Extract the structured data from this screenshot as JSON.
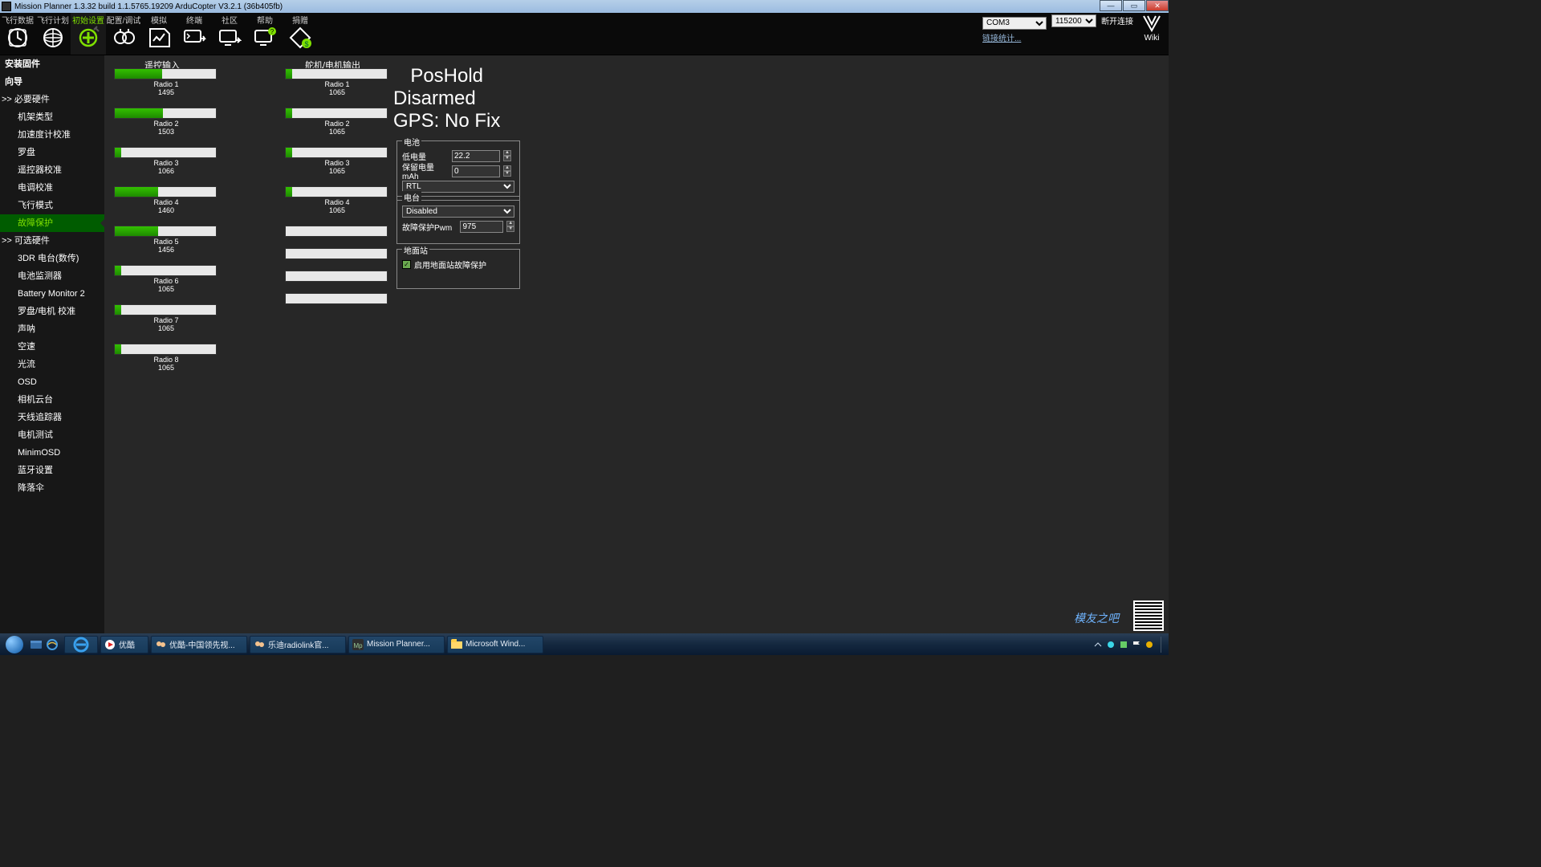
{
  "title": "Mission Planner 1.3.32 build 1.1.5765.19209 ArduCopter V3.2.1 (36b405fb)",
  "menu": {
    "items": [
      "飞行数据",
      "飞行计划",
      "初始设置",
      "配置/调试",
      "模拟",
      "终端",
      "社区",
      "帮助",
      "捐赠"
    ],
    "selected": 2,
    "com_port": "COM3",
    "baud": "115200",
    "disconnect": "断开连接",
    "stats_link": "链接统计...",
    "wiki": "Wiki"
  },
  "sidebar": [
    {
      "t": "安装固件",
      "k": "hdr"
    },
    {
      "t": "向导",
      "k": "hdr"
    },
    {
      "t": "必要硬件",
      "k": "grp"
    },
    {
      "t": "机架类型",
      "k": "sub"
    },
    {
      "t": "加速度计校准",
      "k": "sub"
    },
    {
      "t": "罗盘",
      "k": "sub"
    },
    {
      "t": "遥控器校准",
      "k": "sub"
    },
    {
      "t": "电调校准",
      "k": "sub"
    },
    {
      "t": "飞行模式",
      "k": "sub"
    },
    {
      "t": "故障保护",
      "k": "sub",
      "sel": true
    },
    {
      "t": "可选硬件",
      "k": "grp"
    },
    {
      "t": "3DR 电台(数传)",
      "k": "sub"
    },
    {
      "t": "电池监测器",
      "k": "sub"
    },
    {
      "t": "Battery Monitor 2",
      "k": "sub"
    },
    {
      "t": "罗盘/电机 校准",
      "k": "sub"
    },
    {
      "t": "声呐",
      "k": "sub"
    },
    {
      "t": "空速",
      "k": "sub"
    },
    {
      "t": "光流",
      "k": "sub"
    },
    {
      "t": "OSD",
      "k": "sub"
    },
    {
      "t": "相机云台",
      "k": "sub"
    },
    {
      "t": "天线追踪器",
      "k": "sub"
    },
    {
      "t": "电机测试",
      "k": "sub"
    },
    {
      "t": "MinimOSD",
      "k": "sub"
    },
    {
      "t": "蓝牙设置",
      "k": "sub"
    },
    {
      "t": "降落伞",
      "k": "sub"
    }
  ],
  "columns": {
    "radio_in": "遥控输入",
    "servo_out": "舵机/电机输出"
  },
  "radio_in": [
    {
      "label": "Radio 1",
      "value": 1495,
      "pct": 47
    },
    {
      "label": "Radio 2",
      "value": 1503,
      "pct": 48
    },
    {
      "label": "Radio 3",
      "value": 1066,
      "pct": 6
    },
    {
      "label": "Radio 4",
      "value": 1460,
      "pct": 43
    },
    {
      "label": "Radio 5",
      "value": 1456,
      "pct": 43
    },
    {
      "label": "Radio 6",
      "value": 1065,
      "pct": 6
    },
    {
      "label": "Radio 7",
      "value": 1065,
      "pct": 6
    },
    {
      "label": "Radio 8",
      "value": 1065,
      "pct": 6
    }
  ],
  "servo_out": [
    {
      "label": "Radio 1",
      "value": 1065,
      "pct": 6
    },
    {
      "label": "Radio 2",
      "value": 1065,
      "pct": 6
    },
    {
      "label": "Radio 3",
      "value": 1065,
      "pct": 6
    },
    {
      "label": "Radio 4",
      "value": 1065,
      "pct": 6
    },
    {
      "label": "",
      "value": "",
      "pct": 0
    },
    {
      "label": "",
      "value": "",
      "pct": 0
    },
    {
      "label": "",
      "value": "",
      "pct": 0
    },
    {
      "label": "",
      "value": "",
      "pct": 0
    }
  ],
  "status": {
    "mode": "PosHold",
    "armed": "Disarmed",
    "gps": "GPS: No Fix"
  },
  "fs_battery": {
    "legend": "电池",
    "low_label": "低电量",
    "low_value": "22.2",
    "reserve_label": "保留电量 mAh",
    "reserve_value": "0",
    "action": "RTL"
  },
  "fs_radio": {
    "legend": "电台",
    "mode": "Disabled",
    "pwm_label": "故障保护Pwm",
    "pwm_value": "975"
  },
  "fs_gcs": {
    "legend": "地面站",
    "checkbox_label": "启用地面站故障保护",
    "checked": true
  },
  "taskbar": {
    "tasks": [
      {
        "label": "优酷",
        "color": "#e02020",
        "icon": "play"
      },
      {
        "label": "优酷-中国领先视...",
        "color": "#e02020",
        "icon": "avatar"
      },
      {
        "label": "乐迪radiolink官...",
        "color": "#d16a2c",
        "icon": "avatar"
      },
      {
        "label": "Mission Planner...",
        "color": "#2e2e2e",
        "icon": "mp"
      },
      {
        "label": "Microsoft Wind...",
        "color": "#ffb000",
        "icon": "folder"
      }
    ],
    "first_simple": true
  },
  "footer_logo": "模友之吧"
}
